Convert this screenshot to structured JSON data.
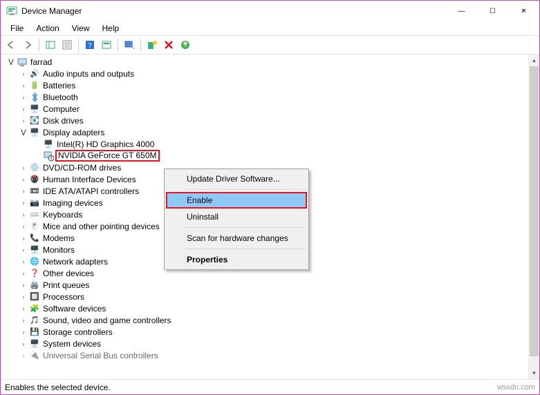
{
  "window": {
    "title": "Device Manager",
    "min": "—",
    "max": "☐",
    "close": "✕"
  },
  "menu": {
    "file": "File",
    "action": "Action",
    "view": "View",
    "help": "Help"
  },
  "tree": {
    "root": "farrad",
    "items": [
      "Audio inputs and outputs",
      "Batteries",
      "Bluetooth",
      "Computer",
      "Disk drives",
      "Display adapters",
      "DVD/CD-ROM drives",
      "Human Interface Devices",
      "IDE ATA/ATAPI controllers",
      "Imaging devices",
      "Keyboards",
      "Mice and other pointing devices",
      "Modems",
      "Monitors",
      "Network adapters",
      "Other devices",
      "Print queues",
      "Processors",
      "Software devices",
      "Sound, video and game controllers",
      "Storage controllers",
      "System devices",
      "Universal Serial Bus controllers"
    ],
    "display_children": [
      "Intel(R) HD Graphics 4000",
      "NVIDIA GeForce GT 650M"
    ]
  },
  "context_menu": {
    "update": "Update Driver Software...",
    "enable": "Enable",
    "uninstall": "Uninstall",
    "scan": "Scan for hardware changes",
    "properties": "Properties"
  },
  "status": {
    "text": "Enables the selected device."
  },
  "watermark": "wsxdn.com"
}
